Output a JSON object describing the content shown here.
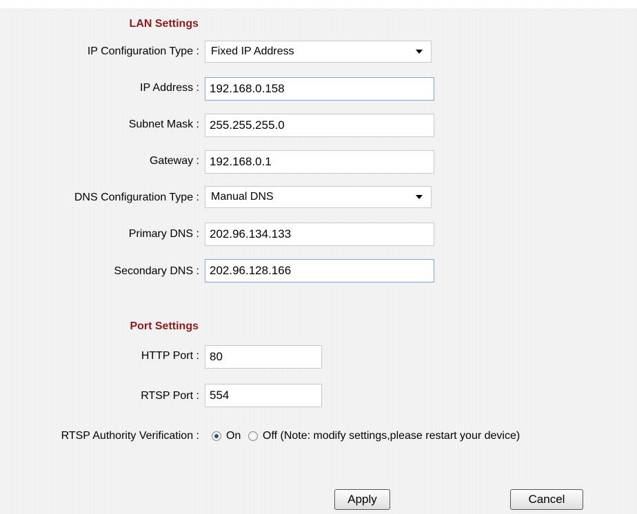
{
  "lan": {
    "title": "LAN Settings",
    "ip_config_type": {
      "label": "IP Configuration Type :",
      "value": "Fixed IP Address"
    },
    "ip_address": {
      "label": "IP Address :",
      "value": "192.168.0.158"
    },
    "subnet_mask": {
      "label": "Subnet Mask :",
      "value": "255.255.255.0"
    },
    "gateway": {
      "label": "Gateway :",
      "value": "192.168.0.1"
    },
    "dns_config_type": {
      "label": "DNS Configuration Type :",
      "value": "Manual DNS"
    },
    "primary_dns": {
      "label": "Primary DNS :",
      "value": "202.96.134.133"
    },
    "secondary_dns": {
      "label": "Secondary DNS :",
      "value": "202.96.128.166"
    }
  },
  "port": {
    "title": "Port Settings",
    "http_port": {
      "label": "HTTP Port :",
      "value": "80"
    },
    "rtsp_port": {
      "label": "RTSP Port :",
      "value": "554"
    },
    "rtsp_auth": {
      "label": "RTSP Authority Verification :",
      "on_label": "On",
      "off_label": "Off (Note: modify settings,please restart your device)",
      "selected": "On"
    }
  },
  "buttons": {
    "apply": "Apply",
    "cancel": "Cancel"
  },
  "colors": {
    "section_title": "#8b1a1a",
    "focus_border": "#7aa7d4"
  }
}
